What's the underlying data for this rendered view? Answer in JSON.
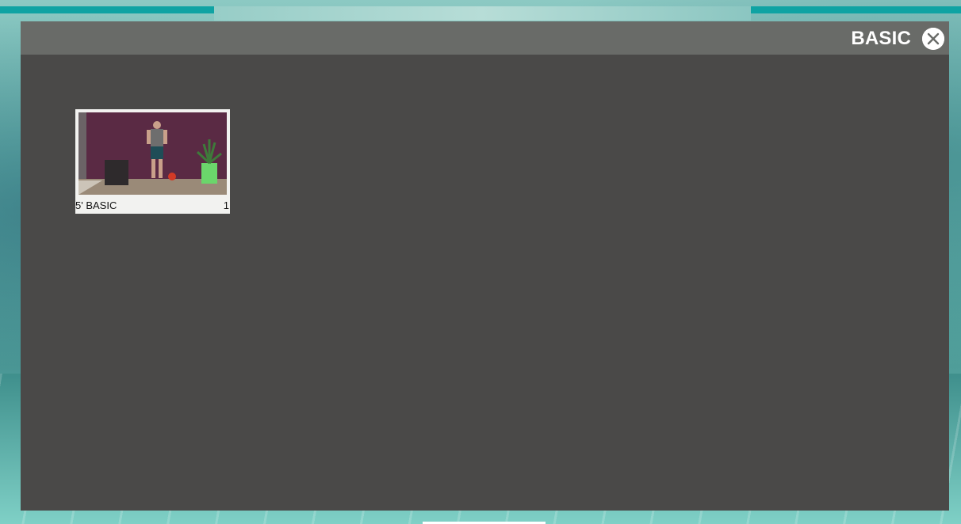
{
  "modal": {
    "title": "BASIC",
    "close_icon": "close-circle-icon"
  },
  "videos": [
    {
      "label": "5' BASIC",
      "count": "1",
      "thumbnail": "trainer-standing-thumbnail"
    }
  ],
  "colors": {
    "panel_bg": "#4a4948",
    "header_bg": "#696b68",
    "accent_teal": "#0fa3a3",
    "wall_purple": "#5a2a44"
  }
}
